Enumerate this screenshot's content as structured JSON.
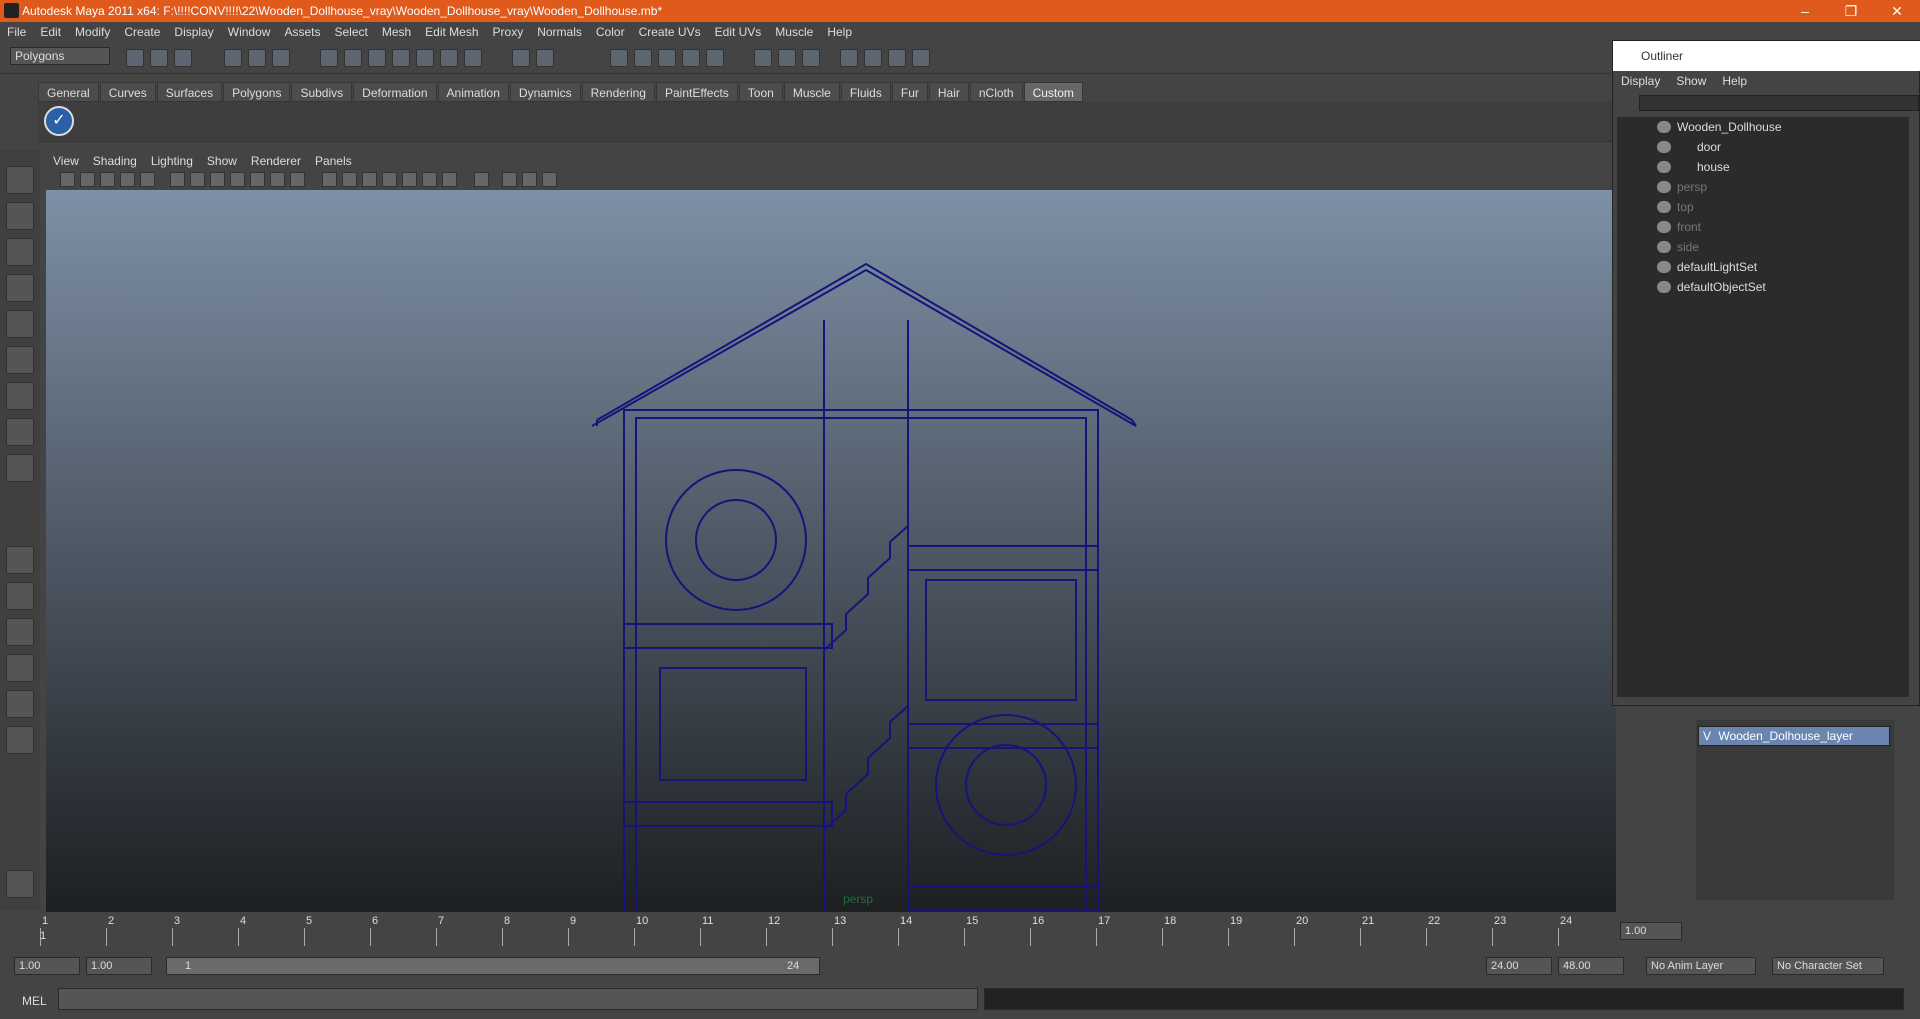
{
  "window": {
    "title": "Autodesk Maya 2011 x64: F:\\!!!!CONV!!!!\\22\\Wooden_Dollhouse_vray\\Wooden_Dollhouse_vray\\Wooden_Dollhouse.mb*",
    "minimize": "–",
    "restore": "❐",
    "close": "✕"
  },
  "menu": [
    "File",
    "Edit",
    "Modify",
    "Create",
    "Display",
    "Window",
    "Assets",
    "Select",
    "Mesh",
    "Edit Mesh",
    "Proxy",
    "Normals",
    "Color",
    "Create UVs",
    "Edit UVs",
    "Muscle",
    "Help"
  ],
  "toolbar": {
    "mode": "Polygons"
  },
  "shelf_tabs": [
    "General",
    "Curves",
    "Surfaces",
    "Polygons",
    "Subdivs",
    "Deformation",
    "Animation",
    "Dynamics",
    "Rendering",
    "PaintEffects",
    "Toon",
    "Muscle",
    "Fluids",
    "Fur",
    "Hair",
    "nCloth",
    "Custom"
  ],
  "shelf_active": "Custom",
  "viewport": {
    "menu": [
      "View",
      "Shading",
      "Lighting",
      "Show",
      "Renderer",
      "Panels"
    ],
    "camera": "persp",
    "wire_color": "#14147a"
  },
  "outliner": {
    "title": "Outliner",
    "menu": [
      "Display",
      "Show",
      "Help"
    ],
    "items": [
      {
        "label": "Wooden_Dollhouse",
        "dim": false
      },
      {
        "label": "door",
        "dim": false
      },
      {
        "label": "house",
        "dim": false
      },
      {
        "label": "persp",
        "dim": true
      },
      {
        "label": "top",
        "dim": true
      },
      {
        "label": "front",
        "dim": true
      },
      {
        "label": "side",
        "dim": true
      },
      {
        "label": "defaultLightSet",
        "dim": false
      },
      {
        "label": "defaultObjectSet",
        "dim": false
      }
    ]
  },
  "layers": {
    "visible_flag": "V",
    "layer_name": "Wooden_Dolhouse_layer"
  },
  "timeline": {
    "ticks": [
      "1",
      "2",
      "3",
      "4",
      "5",
      "6",
      "7",
      "8",
      "9",
      "10",
      "11",
      "12",
      "13",
      "14",
      "15",
      "16",
      "17",
      "18",
      "19",
      "20",
      "21",
      "22",
      "23",
      "24"
    ],
    "current_frame": "1.00",
    "current_marker": "1"
  },
  "range": {
    "start": "1.00",
    "playback_start": "1.00",
    "slider_start": "1",
    "slider_end": "24",
    "playback_end": "24.00",
    "end": "48.00",
    "anim_layer": "No Anim Layer",
    "char_set": "No Character Set"
  },
  "cmd": {
    "label": "MEL"
  }
}
